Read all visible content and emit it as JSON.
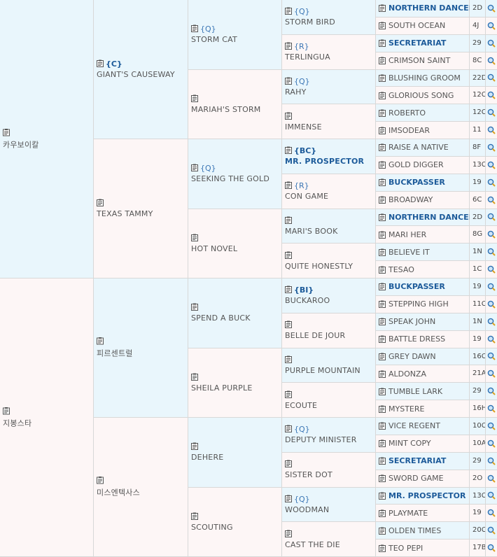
{
  "generation1": [
    {
      "name": "카우보이칼",
      "sex": "sire"
    },
    {
      "name": "지봉스타",
      "sex": "dam"
    }
  ],
  "generation2": [
    {
      "name": "GIANT'S CAUSEWAY",
      "tag": "{C}",
      "tag_bold": true,
      "sex": "sire"
    },
    {
      "name": "TEXAS TAMMY",
      "tag": "",
      "sex": "dam"
    },
    {
      "name": "피르센트럴",
      "tag": "",
      "sex": "sire"
    },
    {
      "name": "미스엔텍사스",
      "tag": "",
      "sex": "dam"
    }
  ],
  "generation3": [
    {
      "name": "STORM CAT",
      "tag": "{Q}",
      "sex": "sire"
    },
    {
      "name": "MARIAH'S STORM",
      "tag": "",
      "sex": "dam"
    },
    {
      "name": "SEEKING THE GOLD",
      "tag": "{Q}",
      "sex": "sire"
    },
    {
      "name": "HOT NOVEL",
      "tag": "",
      "sex": "dam"
    },
    {
      "name": "SPEND A BUCK",
      "tag": "",
      "sex": "sire"
    },
    {
      "name": "SHEILA PURPLE",
      "tag": "",
      "sex": "dam"
    },
    {
      "name": "DEHERE",
      "tag": "",
      "sex": "sire"
    },
    {
      "name": "SCOUTING",
      "tag": "",
      "sex": "dam"
    }
  ],
  "generation4": [
    {
      "name": "STORM BIRD",
      "tag": "{Q}",
      "sex": "sire"
    },
    {
      "name": "TERLINGUA",
      "tag": "{R}",
      "sex": "dam"
    },
    {
      "name": "RAHY",
      "tag": "{Q}",
      "sex": "sire"
    },
    {
      "name": "IMMENSE",
      "tag": "",
      "sex": "dam"
    },
    {
      "name": "MR. PROSPECTOR",
      "tag": "{BC}",
      "tag_bold": true,
      "name_bold": true,
      "sex": "sire"
    },
    {
      "name": "CON GAME",
      "tag": "{R}",
      "sex": "dam"
    },
    {
      "name": "MARI'S BOOK",
      "tag": "",
      "sex": "sire"
    },
    {
      "name": "QUITE HONESTLY",
      "tag": "",
      "sex": "dam"
    },
    {
      "name": "BUCKAROO",
      "tag": "{BI}",
      "tag_bold": true,
      "sex": "sire"
    },
    {
      "name": "BELLE DE JOUR",
      "tag": "",
      "sex": "dam"
    },
    {
      "name": "PURPLE MOUNTAIN",
      "tag": "",
      "sex": "sire"
    },
    {
      "name": "ECOUTE",
      "tag": "",
      "sex": "dam"
    },
    {
      "name": "DEPUTY MINISTER",
      "tag": "{Q}",
      "sex": "sire"
    },
    {
      "name": "SISTER DOT",
      "tag": "",
      "sex": "dam"
    },
    {
      "name": "WOODMAN",
      "tag": "{Q}",
      "sex": "sire"
    },
    {
      "name": "CAST THE DIE",
      "tag": "",
      "sex": "dam"
    }
  ],
  "generation5": [
    {
      "name": "NORTHERN DANCER",
      "code": "2D",
      "bold": true,
      "sex": "sire"
    },
    {
      "name": "SOUTH OCEAN",
      "code": "4J",
      "sex": "dam"
    },
    {
      "name": "SECRETARIAT",
      "code": "29",
      "bold": true,
      "sex": "sire"
    },
    {
      "name": "CRIMSON SAINT",
      "code": "8C",
      "sex": "dam"
    },
    {
      "name": "BLUSHING GROOM",
      "code": "22D",
      "sex": "sire"
    },
    {
      "name": "GLORIOUS SONG",
      "code": "12C",
      "sex": "dam"
    },
    {
      "name": "ROBERTO",
      "code": "12C",
      "sex": "sire"
    },
    {
      "name": "IMSODEAR",
      "code": "11",
      "sex": "dam"
    },
    {
      "name": "RAISE A NATIVE",
      "code": "8F",
      "sex": "sire"
    },
    {
      "name": "GOLD DIGGER",
      "code": "13C",
      "sex": "dam"
    },
    {
      "name": "BUCKPASSER",
      "code": "19",
      "bold": true,
      "sex": "sire"
    },
    {
      "name": "BROADWAY",
      "code": "6C",
      "sex": "dam"
    },
    {
      "name": "NORTHERN DANCER",
      "code": "2D",
      "bold": true,
      "sex": "sire"
    },
    {
      "name": "MARI HER",
      "code": "8G",
      "sex": "dam"
    },
    {
      "name": "BELIEVE IT",
      "code": "1N",
      "sex": "sire"
    },
    {
      "name": "TESAO",
      "code": "1C",
      "sex": "dam"
    },
    {
      "name": "BUCKPASSER",
      "code": "19",
      "bold": true,
      "sex": "sire"
    },
    {
      "name": "STEPPING HIGH",
      "code": "11C",
      "sex": "dam"
    },
    {
      "name": "SPEAK JOHN",
      "code": "1N",
      "sex": "sire"
    },
    {
      "name": "BATTLE DRESS",
      "code": "19",
      "sex": "dam"
    },
    {
      "name": "GREY DAWN",
      "code": "16C",
      "sex": "sire"
    },
    {
      "name": "ALDONZA",
      "code": "21A",
      "sex": "dam"
    },
    {
      "name": "TUMBLE LARK",
      "code": "29",
      "sex": "sire"
    },
    {
      "name": "MYSTERE",
      "code": "16H",
      "sex": "dam"
    },
    {
      "name": "VICE REGENT",
      "code": "10C",
      "sex": "sire"
    },
    {
      "name": "MINT COPY",
      "code": "10A",
      "sex": "dam"
    },
    {
      "name": "SECRETARIAT",
      "code": "29",
      "bold": true,
      "sex": "sire"
    },
    {
      "name": "SWORD GAME",
      "code": "2O",
      "sex": "dam"
    },
    {
      "name": "MR. PROSPECTOR",
      "code": "13C",
      "bold": true,
      "sex": "sire"
    },
    {
      "name": "PLAYMATE",
      "code": "19",
      "sex": "dam"
    },
    {
      "name": "OLDEN TIMES",
      "code": "20C",
      "sex": "sire"
    },
    {
      "name": "TEO PEPI",
      "code": "17B",
      "sex": "dam"
    }
  ],
  "icons": {
    "record": "clipboard-icon",
    "search": "magnifier-icon"
  },
  "colors": {
    "sire_bg": "#e9f6fc",
    "dam_bg": "#fdf6f6",
    "highlight_text": "#1d5b9a",
    "tag_text": "#3b76b5"
  }
}
